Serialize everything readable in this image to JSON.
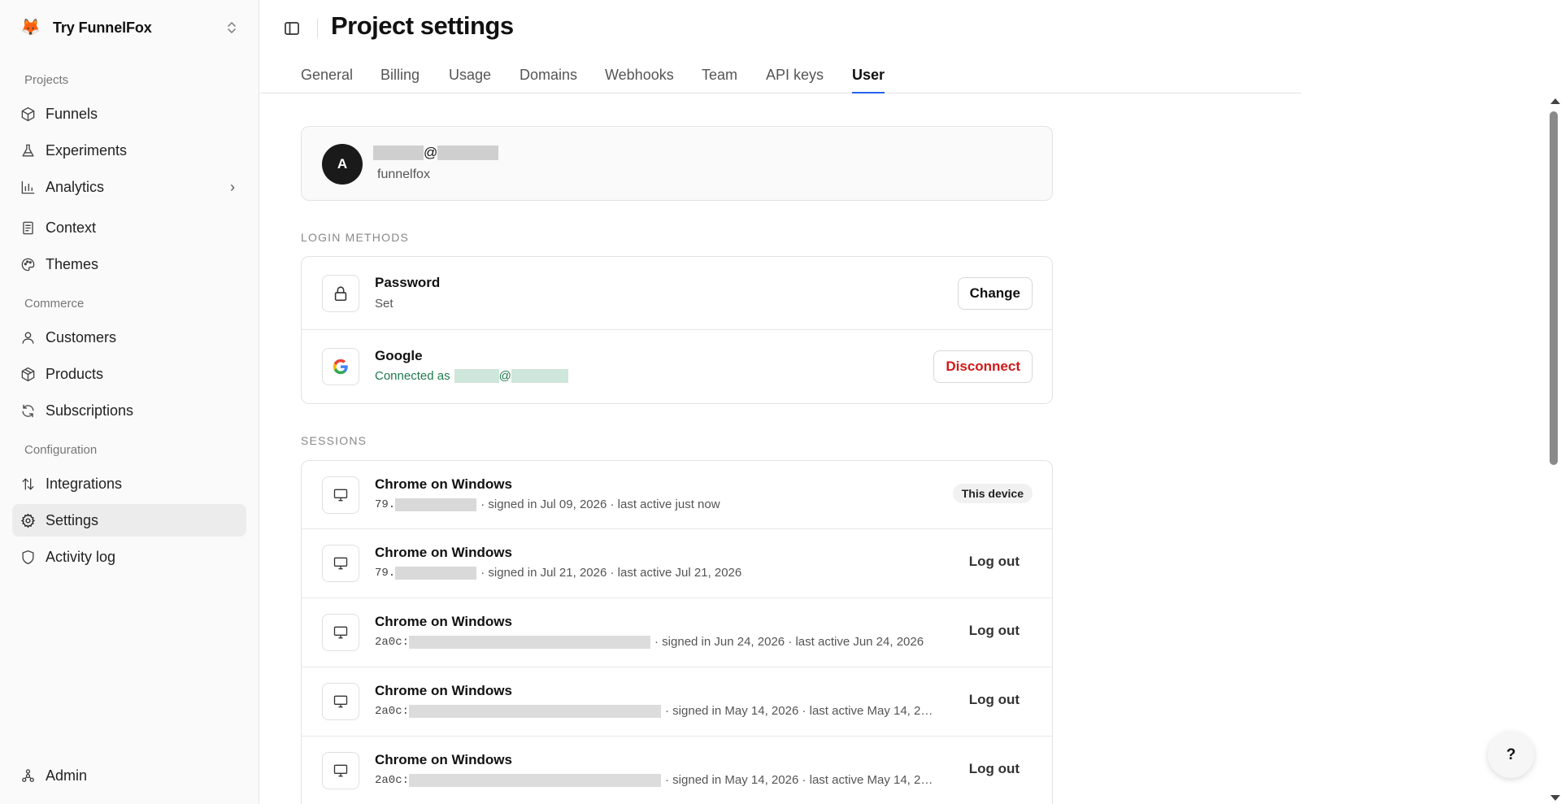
{
  "workspace": {
    "name": "Try FunnelFox",
    "logo": "fox-icon"
  },
  "sidebar": {
    "sections": [
      "Projects",
      "Commerce",
      "Configuration"
    ],
    "projects": [
      {
        "label": "Funnels",
        "icon": "box-icon"
      },
      {
        "label": "Experiments",
        "icon": "flask-icon"
      },
      {
        "label": "Analytics",
        "icon": "chart-icon"
      },
      {
        "label": "Context",
        "icon": "document-icon"
      },
      {
        "label": "Themes",
        "icon": "palette-icon"
      }
    ],
    "commerce": [
      {
        "label": "Customers",
        "icon": "user-icon"
      },
      {
        "label": "Products",
        "icon": "package-icon"
      },
      {
        "label": "Subscriptions",
        "icon": "refresh-icon"
      }
    ],
    "configuration": [
      {
        "label": "Integrations",
        "icon": "arrows-icon"
      },
      {
        "label": "Settings",
        "icon": "gear-icon"
      },
      {
        "label": "Activity log",
        "icon": "shield-icon"
      }
    ],
    "admin": {
      "label": "Admin",
      "icon": "admin-icon"
    }
  },
  "header": {
    "title": "Project settings"
  },
  "tabs": [
    "General",
    "Billing",
    "Usage",
    "Domains",
    "Webhooks",
    "Team",
    "API keys",
    "User"
  ],
  "active_tab": "User",
  "user": {
    "avatar_initial": "A",
    "email_at": "@",
    "org": "funnelfox"
  },
  "login_methods": {
    "heading": "LOGIN METHODS",
    "password": {
      "title": "Password",
      "status": "Set",
      "button": "Change"
    },
    "google": {
      "title": "Google",
      "status_prefix": "Connected as",
      "status_at": "@",
      "button": "Disconnect"
    }
  },
  "sessions": {
    "heading": "SESSIONS",
    "items": [
      {
        "title": "Chrome on Windows",
        "ip_prefix": "79.",
        "details": "· signed in Jul 09, 2026 · last active just now",
        "action": "This device",
        "current": true
      },
      {
        "title": "Chrome on Windows",
        "ip_prefix": "79.",
        "details": "· signed in Jul 21, 2026 · last active Jul 21, 2026",
        "action": "Log out",
        "current": false
      },
      {
        "title": "Chrome on Windows",
        "ip_prefix": "2a0c:",
        "details": "· signed in Jun 24, 2026 · last active Jun 24, 2026",
        "action": "Log out",
        "current": false
      },
      {
        "title": "Chrome on Windows",
        "ip_prefix": "2a0c:",
        "details": "· signed in May 14, 2026 · last active May 14, 2…",
        "action": "Log out",
        "current": false
      },
      {
        "title": "Chrome on Windows",
        "ip_prefix": "2a0c:",
        "details": "· signed in May 14, 2026 · last active May 14, 2…",
        "action": "Log out",
        "current": false
      }
    ]
  },
  "help": {
    "label": "?"
  },
  "colors": {
    "accent": "#2563eb",
    "danger": "#d11a1a",
    "connected": "#1f7a4d"
  }
}
